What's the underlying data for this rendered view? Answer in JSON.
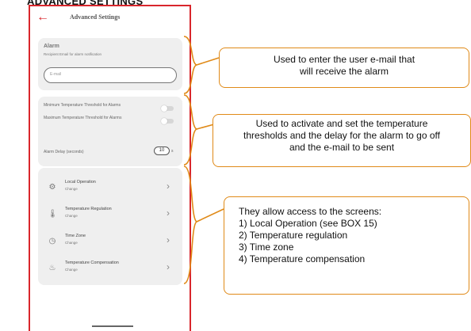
{
  "header": {
    "title": "ADVANCED SETTINGS"
  },
  "topbar": {
    "back_glyph": "←",
    "title": "Advanced Settings"
  },
  "alarm": {
    "title": "Alarm",
    "subtitle": "Recipient Email for alarm notification",
    "email_placeholder": "E-mail"
  },
  "thresholds": {
    "min_label": "Minimum Temperature Threshold for Alarms",
    "min_enabled": false,
    "max_label": "Maximum Temperature Threshold for Alarms",
    "max_enabled": false,
    "delay_label": "Alarm Delay (seconds)",
    "delay_value": "10",
    "delay_unit": "s"
  },
  "menu": {
    "items": [
      {
        "label": "Local Operation",
        "sub": "Change",
        "icon": "gear-icon"
      },
      {
        "label": "Temperature Regulation",
        "sub": "Change",
        "icon": "thermometer-icon"
      },
      {
        "label": "Time Zone",
        "sub": "Change",
        "icon": "clock-icon"
      },
      {
        "label": "Temperature Compensation",
        "sub": "Change",
        "icon": "thermo-compensation-icon"
      }
    ]
  },
  "callouts": {
    "c1": [
      "Used to enter the user e-mail that",
      "will receive the alarm"
    ],
    "c2": [
      "Used to activate and set the temperature",
      "thresholds and the delay for the alarm to go off",
      "and the e-mail to be sent"
    ],
    "c3": [
      "They allow access to the screens:",
      "1) Local Operation (see BOX 15)",
      "2) Temperature regulation",
      "3) Time zone",
      "4) Temperature compensation"
    ]
  },
  "colors": {
    "accent": "#d9262c",
    "callout_border": "#e08a18"
  }
}
